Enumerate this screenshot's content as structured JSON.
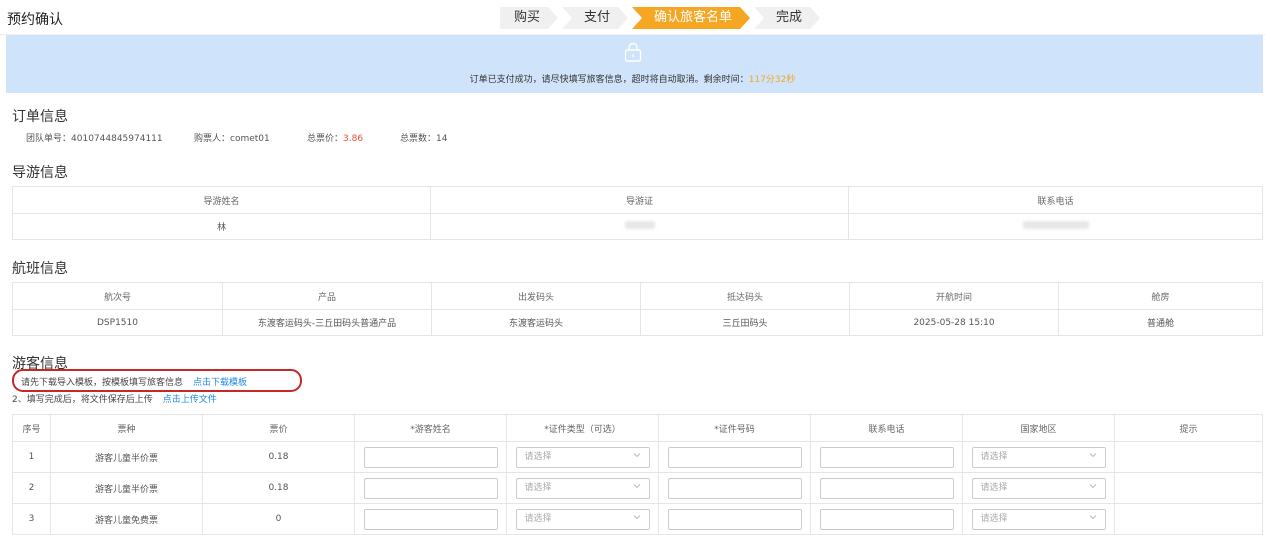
{
  "page_title": "预约确认",
  "steps": [
    "购买",
    "支付",
    "确认旅客名单",
    "完成"
  ],
  "banner": {
    "message": "订单已支付成功，请尽快填写旅客信息，超时将自动取消。剩余时间：",
    "remaining_time": "117分32秒"
  },
  "order": {
    "title": "订单信息",
    "group_no_label": "团队单号：",
    "group_no": "4010744845974111",
    "buyer_label": "购票人：",
    "buyer": "comet01",
    "total_price_label": "总票价：",
    "total_price": "3.86",
    "total_tickets_label": "总票数：",
    "total_tickets": "14"
  },
  "guide": {
    "title": "导游信息",
    "headers": [
      "导游姓名",
      "导游证",
      "联系电话"
    ],
    "row": [
      "林",
      "",
      ""
    ]
  },
  "flight": {
    "title": "航班信息",
    "headers": [
      "航次号",
      "产品",
      "出发码头",
      "抵达码头",
      "开航时间",
      "舱房"
    ],
    "row": [
      "DSP1510",
      "东渡客运码头-三丘田码头普通产品",
      "东渡客运码头",
      "三丘田码头",
      "2025-05-28 15:10",
      "普通舱"
    ]
  },
  "tourists": {
    "title": "游客信息",
    "hint1_text": "、请先下载导入模板，按模板填写旅客信息",
    "hint1_link": "点击下载模板",
    "hint2_text": "2、填写完成后，将文件保存后上传",
    "hint2_link": "点击上传文件",
    "headers": [
      "序号",
      "票种",
      "票价",
      "*游客姓名",
      "*证件类型（可选）",
      "*证件号码",
      "联系电话",
      "国家地区",
      "提示"
    ],
    "select_placeholder": "请选择",
    "rows": [
      {
        "no": "1",
        "type": "游客儿童半价票",
        "price": "0.18"
      },
      {
        "no": "2",
        "type": "游客儿童半价票",
        "price": "0.18"
      },
      {
        "no": "3",
        "type": "游客儿童免费票",
        "price": "0"
      }
    ]
  }
}
